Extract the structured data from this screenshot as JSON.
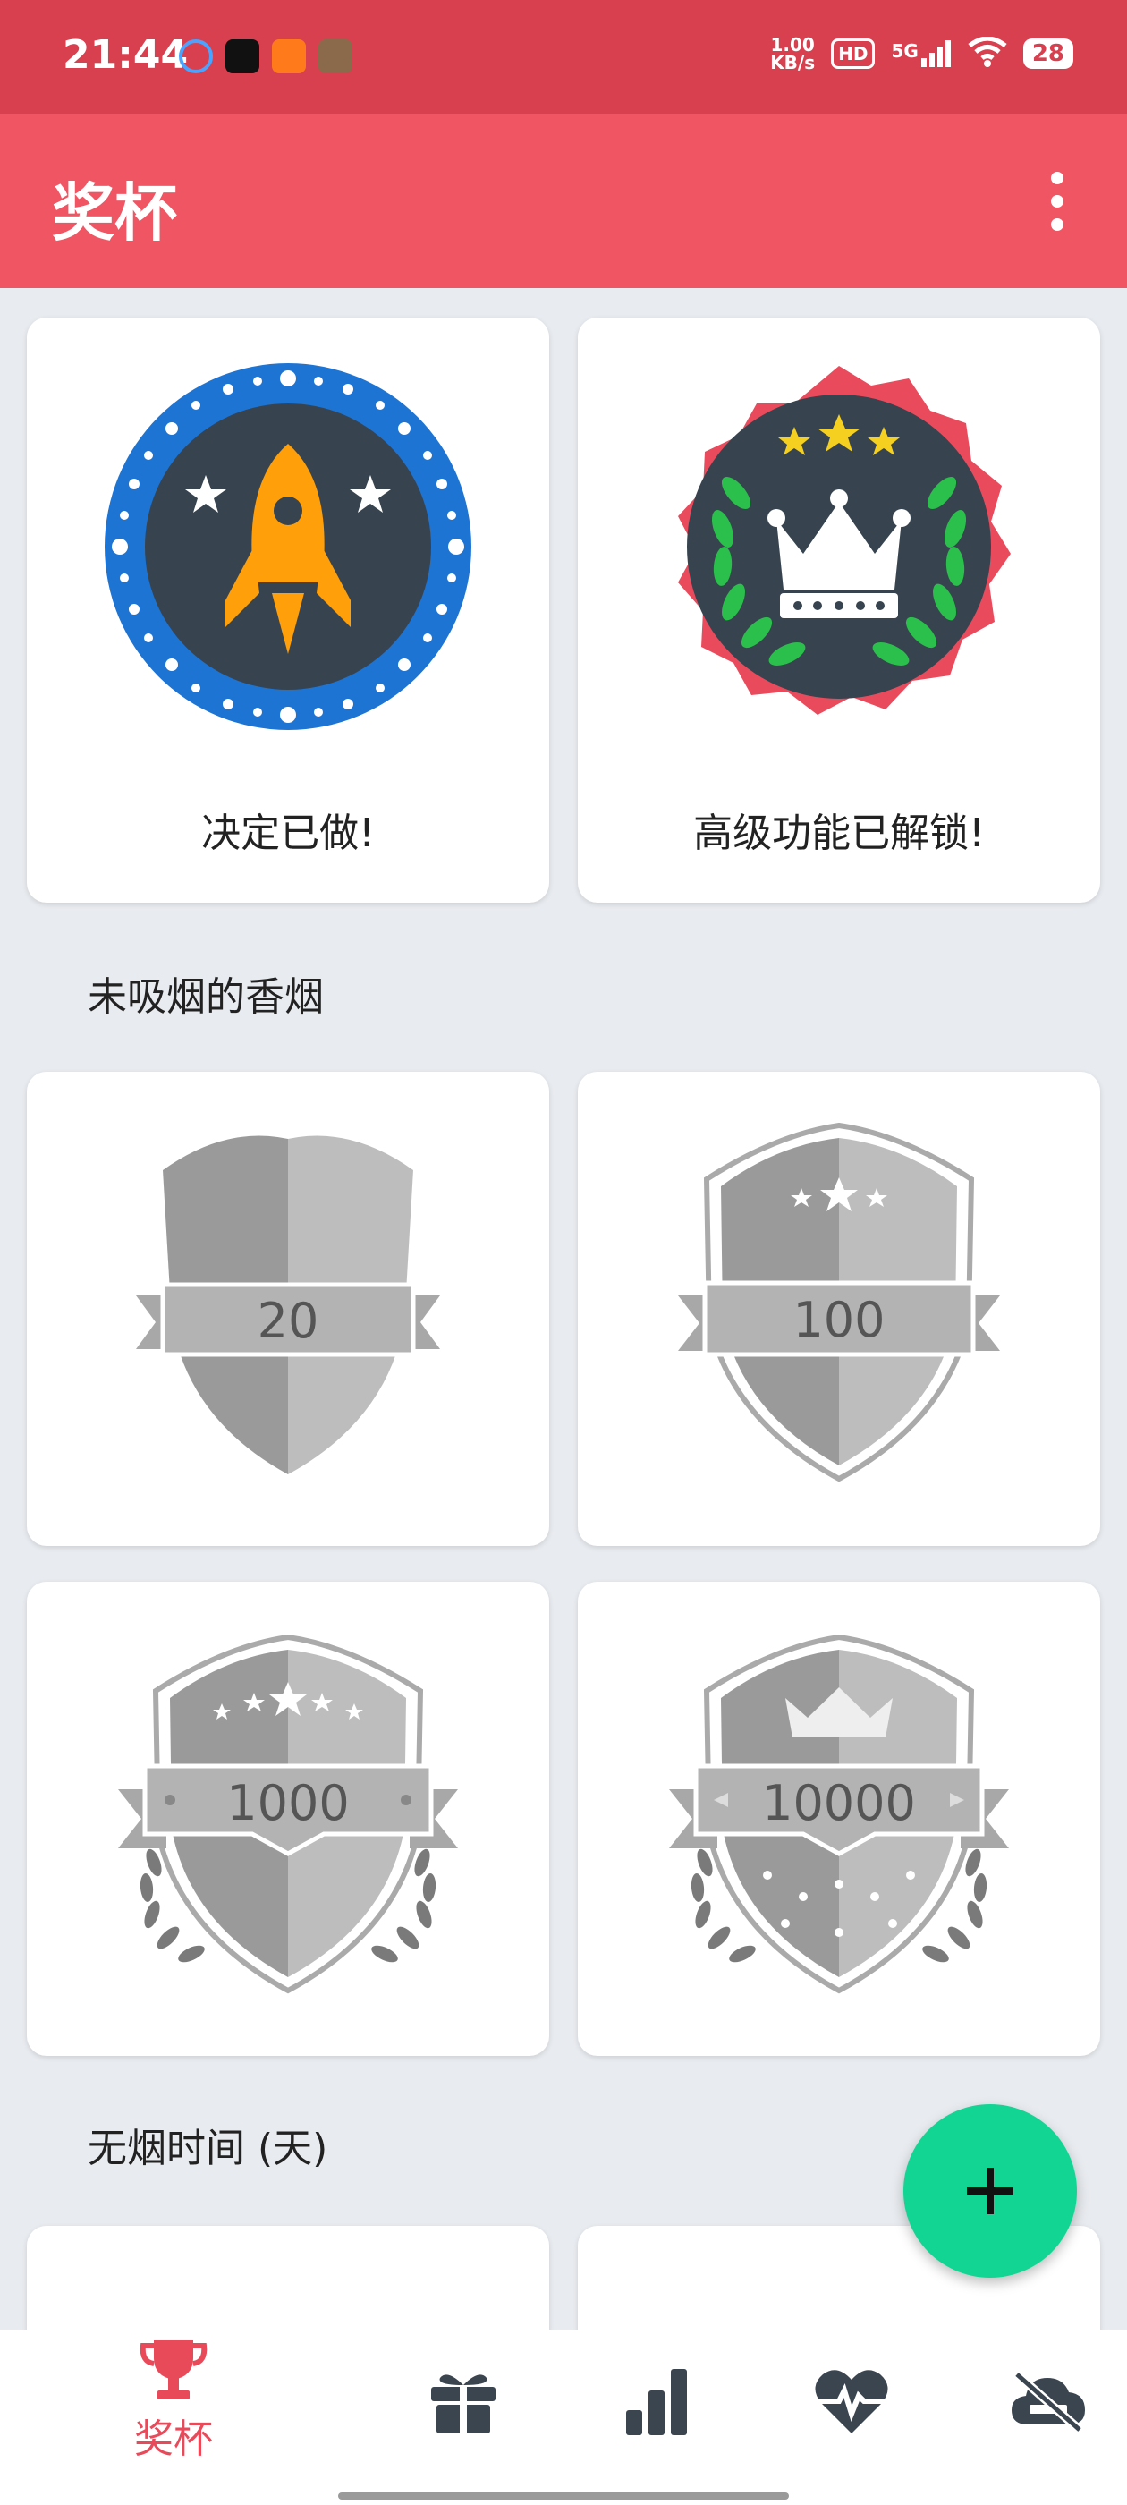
{
  "status_bar": {
    "time": "21:44",
    "net_speed_value": "1.00",
    "net_speed_unit": "KB/s",
    "hd": "HD",
    "network": "5G",
    "battery": "28"
  },
  "app_bar": {
    "title": "奖杯"
  },
  "top_awards": [
    {
      "label": "决定已做!"
    },
    {
      "label": "高级功能已解锁!"
    }
  ],
  "sections": {
    "cigarettes_title": "未吸烟的香烟",
    "smokefree_title": "无烟时间 (天)"
  },
  "cigarette_badges": [
    "20",
    "100",
    "1000",
    "10000"
  ],
  "bottom_nav": {
    "trophies_label": "奖杯"
  },
  "colors": {
    "status_bar": "#d8404f",
    "app_bar": "#f05563",
    "fab": "#12d594",
    "active_tab": "#e94a5a"
  }
}
